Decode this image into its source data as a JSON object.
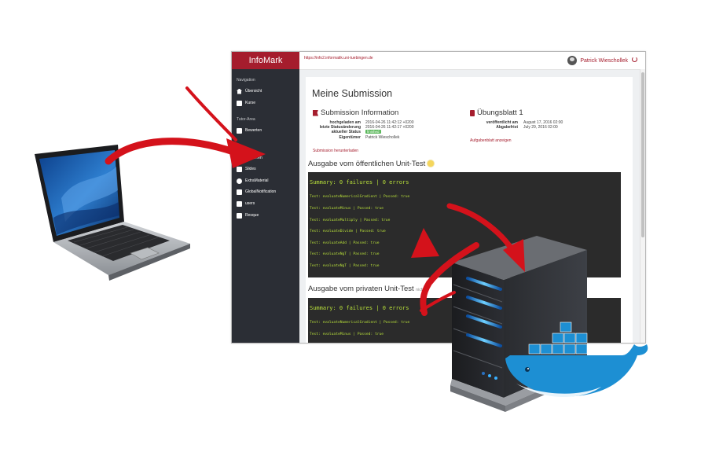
{
  "app": {
    "brand": "InfoMark",
    "url": "https://info2.informatik.uni-tuebingen.de",
    "user_name": "Patrick Wieschollek"
  },
  "sidebar": {
    "navigation_heading": "Navigation",
    "tutor_heading": "Tutor-Area",
    "items": [
      {
        "label": "Übersicht",
        "icon": "home-icon"
      },
      {
        "label": "Kurse",
        "icon": "book-icon"
      },
      {
        "label": "Bewerten",
        "icon": "check-icon"
      },
      {
        "label": "...en",
        "icon": "list-icon"
      },
      {
        "label": "Slides",
        "icon": "slides-icon"
      },
      {
        "label": "ExtraMaterial",
        "icon": "attachment-icon"
      },
      {
        "label": "GlobalNotification",
        "icon": "message-icon"
      },
      {
        "label": "users",
        "icon": "user-icon"
      },
      {
        "label": "Resque",
        "icon": "wrench-icon"
      }
    ]
  },
  "main": {
    "page_title": "Meine Submission",
    "submission_info": {
      "title": "Submission Information",
      "rows": [
        {
          "key": "hochgeladen am",
          "value": "2016-04-26 11:42:12 +0200"
        },
        {
          "key": "letzte Statusänderung",
          "value": "2016-04-26 11:42:17 +0200"
        },
        {
          "key": "aktueller Status",
          "value": "finished"
        },
        {
          "key": "Eigentümer",
          "value": "Patrick Wieschollek"
        }
      ],
      "download_link": "Submission herunterladen"
    },
    "sheet": {
      "title": "Übungsblatt 1",
      "rows": [
        {
          "key": "veröffentlicht am",
          "value": "August 17, 2016 02:00"
        },
        {
          "key": "Abgabefrist",
          "value": "July 29, 2016 02:00"
        }
      ],
      "show_link": "Aufgabenblatt anzeigen"
    },
    "public_output": {
      "title": "Ausgabe vom öffentlichen Unit-Test",
      "summary": "Summary: 0 failures | 0 errors",
      "lines": [
        "Test: evaluateNumericalGradient | Passed: true",
        "Test: evaluateMinus | Passed: true",
        "Test: evaluateMultiply | Passed: true",
        "Test: evaluateDivide | Passed: true",
        "Test: evaluateAdd | Passed: true",
        "Test: evaluateNgT | Passed: true",
        "Test: evaluateNgT | Passed: true"
      ]
    },
    "private_output": {
      "title": "Ausgabe vom privaten Unit-Test",
      "note": "nicht fü",
      "summary": "Summary: 0 failures | 0 errors",
      "lines": [
        "Test: evaluateNumericalGradient | Passed: true",
        "Test: evaluateMinus | Passed: true"
      ]
    }
  },
  "colors": {
    "brand": "#a51d2d",
    "sidebar": "#2b2e35",
    "console_bg": "#2b2b2b",
    "console_text": "#b8e03a",
    "arrow_red": "#d4121b",
    "docker_blue": "#1d8fd3",
    "server_led": "#3ab0ff"
  }
}
